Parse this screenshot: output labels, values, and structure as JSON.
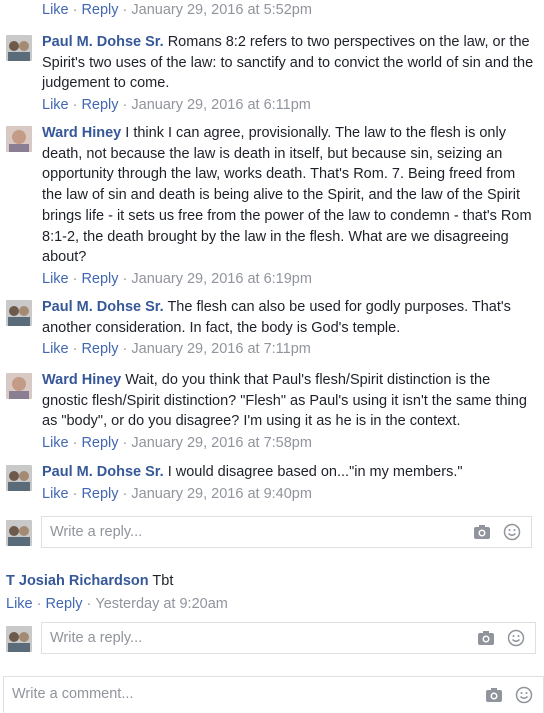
{
  "actions": {
    "like": "Like",
    "reply": "Reply",
    "separator": "·"
  },
  "top_meta_time": "January 29, 2016 at 5:52pm",
  "comments": [
    {
      "author": "Paul M. Dohse Sr.",
      "text": "Romans 8:2 refers to two perspectives on the law, or the Spirit's two uses of the law: to sanctify and to convict the world of sin and the judgement to come.",
      "time": "January 29, 2016 at 6:11pm"
    },
    {
      "author": "Ward Hiney",
      "text": "I think I can agree, provisionally. The law to the flesh is only death, not because the law is death in itself, but because sin, seizing an opportunity through the law, works death. That's Rom. 7. Being freed from the law of sin and death is being alive to the Spirit, and the law of the Spirit brings life - it sets us free from the power of the law to condemn - that's Rom 8:1-2, the death brought by the law in the flesh. What are we disagreeing about?",
      "time": "January 29, 2016 at 6:19pm"
    },
    {
      "author": "Paul M. Dohse Sr.",
      "text": "The flesh can also be used for godly purposes. That's another consideration. In fact, the body is God's temple.",
      "time": "January 29, 2016 at 7:11pm"
    },
    {
      "author": "Ward Hiney",
      "text": "Wait, do you think that Paul's flesh/Spirit distinction is the gnostic flesh/Spirit distinction? \"Flesh\" as Paul's using it isn't the same thing as \"body\", or do you disagree? I'm using it as he is in the context.",
      "time": "January 29, 2016 at 7:58pm"
    },
    {
      "author": "Paul M. Dohse Sr.",
      "text": "I would disagree based on...\"in my members.\"",
      "time": "January 29, 2016 at 9:40pm"
    }
  ],
  "reply_placeholder": "Write a reply...",
  "top_comment": {
    "author": "T Josiah Richardson",
    "text": "Tbt",
    "time": "Yesterday at 9:20am"
  },
  "comment_placeholder": "Write a comment...",
  "icons": {
    "camera": "camera-icon",
    "emoji": "emoji-icon"
  },
  "colors": {
    "link": "#4267b2",
    "author": "#365899",
    "meta": "#90949c",
    "border": "#dddfe2"
  }
}
